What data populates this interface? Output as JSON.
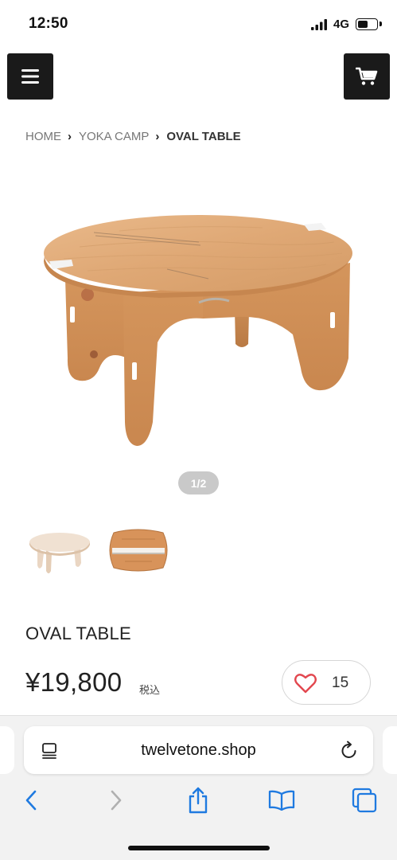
{
  "status_bar": {
    "time": "12:50",
    "network": "4G",
    "signal_icon": "signal-bars-icon",
    "battery_icon": "battery-icon",
    "battery_level": 0.55
  },
  "header": {
    "menu_icon": "hamburger-menu-icon",
    "cart_icon": "shopping-cart-icon"
  },
  "breadcrumb": {
    "items": [
      "HOME",
      "YOKA CAMP",
      "OVAL TABLE"
    ],
    "separator_icon": "chevron-right-icon"
  },
  "gallery": {
    "pager": "1/2",
    "current_index": 1,
    "total": 2,
    "thumbnails": [
      "oval-table-assembled",
      "oval-table-flat-packed"
    ]
  },
  "product": {
    "name": "OVAL TABLE",
    "price": "¥19,800",
    "tax_label": "税込",
    "favorite_count": "15",
    "favorite_icon": "heart-outline-icon",
    "favorite_color": "#e2474f"
  },
  "browser": {
    "url": "twelvetone.shop",
    "reader_icon": "reader-mode-icon",
    "reload_icon": "reload-icon",
    "toolbar": [
      "back-icon",
      "forward-icon",
      "share-icon",
      "bookmarks-icon",
      "tabs-icon"
    ],
    "accent_color": "#1f7ae0"
  }
}
